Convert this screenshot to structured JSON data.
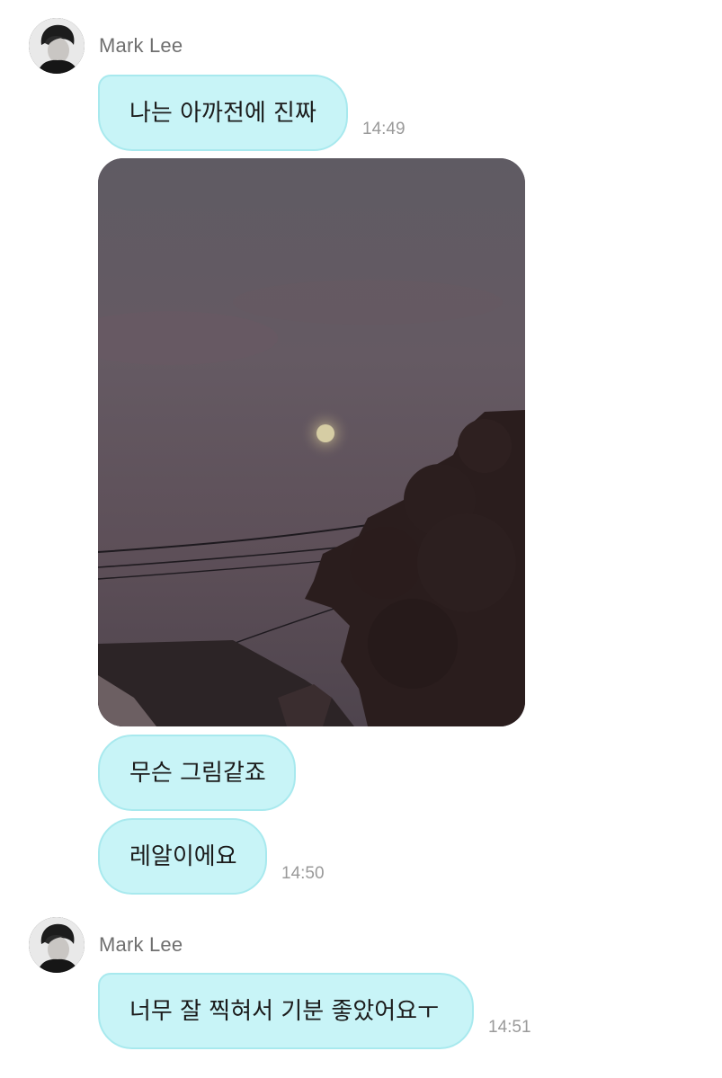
{
  "messages": [
    {
      "sender": "Mark Lee",
      "avatar_icon": "profile-photo",
      "bubbles": [
        {
          "text": "나는 아까전에 진짜",
          "time": "14:49"
        },
        {
          "image": "moon-sky-photo"
        },
        {
          "text": "무슨 그림같죠"
        },
        {
          "text": "레알이에요",
          "time": "14:50"
        }
      ]
    },
    {
      "sender": "Mark Lee",
      "avatar_icon": "profile-photo",
      "bubbles": [
        {
          "text": "너무 잘 찍혀서 기분 좋았어요ㅜ",
          "time": "14:51"
        }
      ]
    }
  ],
  "colors": {
    "bubble_fill": "#c8f4f7",
    "bubble_border": "#a8e9ee",
    "name_text": "#6f6f6f",
    "time_text": "#9a9a9a"
  }
}
